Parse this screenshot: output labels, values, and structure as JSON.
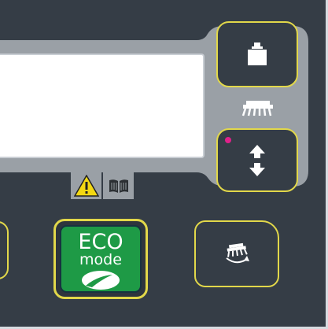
{
  "panel": {
    "background_color": "#353d46",
    "accent_color": "#e2d84a",
    "bezel_color": "#9aa0a6"
  },
  "buttons": {
    "weight": {
      "icon": "weight-icon"
    },
    "updown": {
      "icon": "up-down-arrows-icon",
      "led_color": "#e0218a",
      "led_on": true
    },
    "rotate": {
      "icon": "brush-rotate-icon"
    },
    "eco": {
      "title": "ECO",
      "subtitle": "mode",
      "icon": "leaf-icon",
      "color": "#1e9a46"
    }
  },
  "indicators": {
    "brush_label_icon": "brush-deck-icon",
    "warning_icon": "warning-triangle-icon",
    "manual_icon": "book-manual-icon"
  }
}
